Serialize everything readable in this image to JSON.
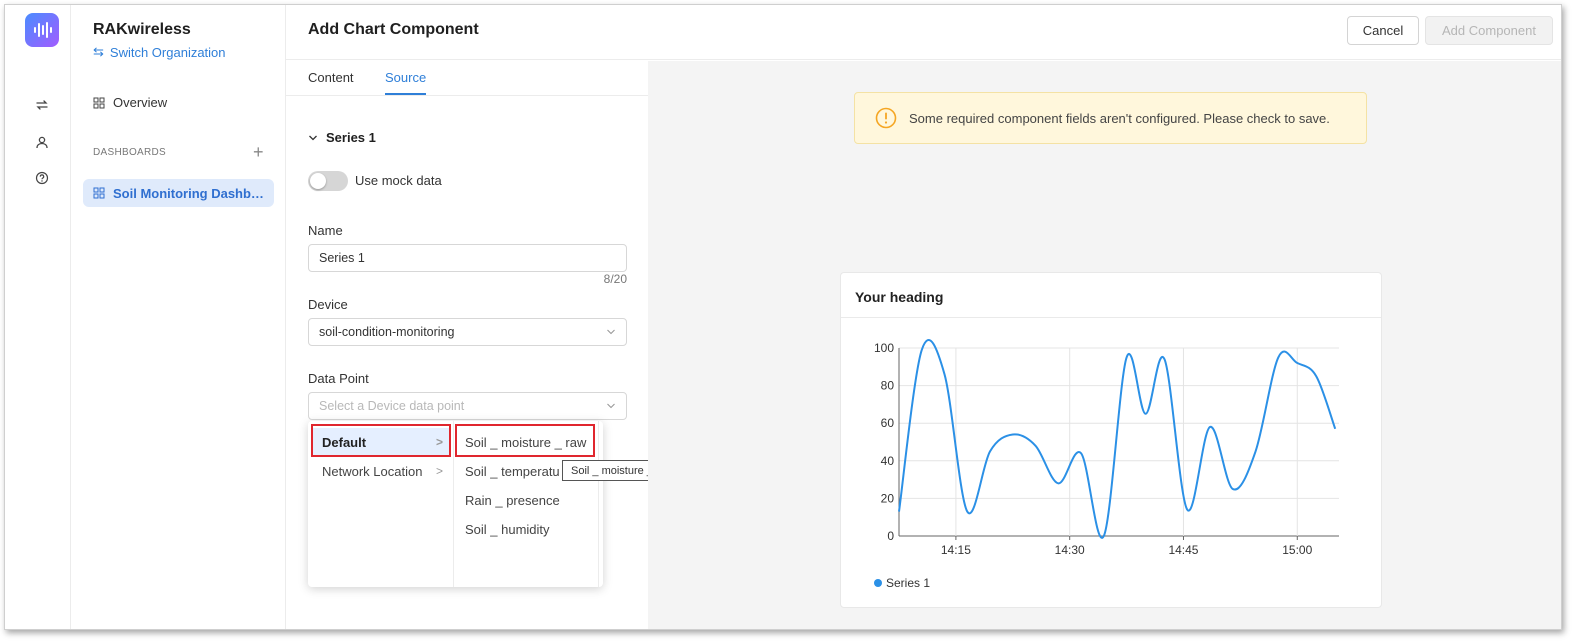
{
  "org": {
    "name": "RAKwireless",
    "switch_label": "Switch Organization"
  },
  "rail": {
    "icons": [
      "swap-icon",
      "user-icon",
      "help-icon"
    ]
  },
  "nav": {
    "overview": "Overview",
    "dashboards_section": "DASHBOARDS",
    "dashboards": [
      {
        "label": "Soil Monitoring Dashb…"
      }
    ]
  },
  "header": {
    "title": "Add Chart Component",
    "cancel": "Cancel",
    "add": "Add Component"
  },
  "tabs": [
    {
      "label": "Content"
    },
    {
      "label": "Source",
      "active": true
    }
  ],
  "form": {
    "series_title": "Series 1",
    "mock_label": "Use mock data",
    "mock_on": false,
    "name_label": "Name",
    "name_value": "Series 1",
    "name_counter": "8/20",
    "device_label": "Device",
    "device_value": "soil-condition-monitoring",
    "datapoint_label": "Data Point",
    "datapoint_placeholder": "Select a Device data point"
  },
  "dropdown": {
    "groups": [
      "Default",
      "Network Location"
    ],
    "items": [
      "Soil _ moisture _ raw",
      "Soil _ temperatu",
      "Rain _ presence",
      "Soil _ humidity"
    ],
    "tooltip": "Soil _ moisture _ raw"
  },
  "alert": {
    "text": "Some required component fields aren't configured. Please check to save.",
    "icon": "warning-circle-icon",
    "color": "#f5a623"
  },
  "colors": {
    "accent": "#2f7fd8",
    "series": "#2b90e6",
    "highlight": "#e0262e"
  },
  "preview": {
    "heading": "Your heading",
    "chart_data": {
      "type": "line",
      "x_unit": "time",
      "x_ticks": [
        "14:15",
        "14:30",
        "14:45",
        "15:00"
      ],
      "y_ticks": [
        0,
        20,
        40,
        60,
        80,
        100
      ],
      "ylim": [
        0,
        100
      ],
      "xlim_minutes": [
        0,
        58
      ],
      "x_tick_positions_minutes": [
        7.5,
        22.5,
        37.5,
        52.5
      ],
      "series": [
        {
          "name": "Series 1",
          "points": [
            [
              0,
              13
            ],
            [
              3,
              99
            ],
            [
              6,
              86
            ],
            [
              9,
              13
            ],
            [
              12,
              45
            ],
            [
              15,
              54
            ],
            [
              18,
              48
            ],
            [
              21,
              28
            ],
            [
              24,
              44
            ],
            [
              27,
              0
            ],
            [
              30,
              95
            ],
            [
              32.5,
              65
            ],
            [
              35,
              94
            ],
            [
              38,
              14
            ],
            [
              41,
              58
            ],
            [
              44,
              25
            ],
            [
              47,
              45
            ],
            [
              50,
              95
            ],
            [
              52.5,
              92
            ],
            [
              55,
              85
            ],
            [
              57.5,
              57
            ]
          ]
        }
      ],
      "legend": "bottom-left",
      "grid": true
    }
  }
}
